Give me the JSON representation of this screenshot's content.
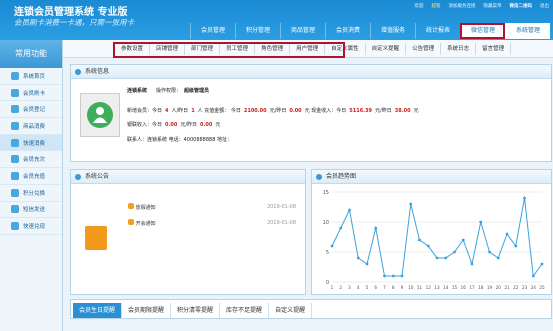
{
  "app": {
    "title": "连锁会员管理系统 专业版",
    "slogan": "会员刷卡消费一卡通，只需一张用卡"
  },
  "toplinks": [
    "欢迎",
    "超管",
    "添加服务连接",
    "隐藏菜单",
    "微信二维码",
    "退出"
  ],
  "nav": [
    "会员管理",
    "积分管理",
    "商品管理",
    "会员消费",
    "增值服务",
    "统计报表",
    "微信管理",
    "系统管理"
  ],
  "subnav": [
    "参数设置",
    "店铺管理",
    "部门管理",
    "员工管理",
    "角色管理",
    "用户管理",
    "自定义属性",
    "自定义提醒",
    "公告管理",
    "系统日志",
    "留言管理"
  ],
  "sidebar": {
    "title": "常用功能",
    "items": [
      "系统首页",
      "会员刷卡",
      "会员登记",
      "商品消费",
      "快速消费",
      "会员充次",
      "会员充值",
      "积分兑换",
      "短信发送",
      "快速兑现"
    ]
  },
  "sysinfo": {
    "title": "系统信息",
    "store": "连锁系统",
    "role_label": "操作权限：",
    "role": "超级管理员",
    "row2": {
      "l1": "新增会员：今日",
      "v1": "4",
      "l2": "人/昨日",
      "v2": "1",
      "l3": "人  充值金额：  今日",
      "v3": "2100.00",
      "l4": "元/昨日",
      "v4": "0.00",
      "l5": "元  现金收入：今日",
      "v5": "5116.39",
      "l6": "元/昨日",
      "v6": "38.00",
      "l7": "元"
    },
    "row3": {
      "l1": "银联收入：今日",
      "v1": "0.00",
      "l2": "元/昨日",
      "v2": "0.00",
      "l3": "元"
    },
    "row4": "联系人：连锁系统   电话：4000888888   地址："
  },
  "notice": {
    "title": "系统公告",
    "items": [
      {
        "text": "放假通知",
        "date": "2019-01-08"
      },
      {
        "text": "开会通知",
        "date": "2019-01-08"
      }
    ]
  },
  "trend": {
    "title": "会员趋势图"
  },
  "tabs": [
    "会员生日提醒",
    "会员期限提醒",
    "积分清零提醒",
    "库存不足提醒",
    "自定义提醒"
  ],
  "colors": {
    "header": "#1a8ad3",
    "accent": "#2b8fd3",
    "highlight": "#b0132b",
    "line": "#3aa3de"
  },
  "chart_data": {
    "type": "line",
    "x": [
      1,
      2,
      3,
      4,
      5,
      6,
      7,
      8,
      9,
      10,
      11,
      12,
      13,
      14,
      15,
      16,
      17,
      18,
      19,
      20,
      21,
      22,
      23,
      24,
      25
    ],
    "series": [
      {
        "values": [
          6,
          9,
          12,
          4,
          3,
          9,
          1,
          1,
          1,
          13,
          7,
          6,
          4,
          4,
          5,
          7,
          3,
          10,
          5,
          4,
          8,
          6,
          14,
          1,
          3
        ]
      }
    ],
    "ylim": [
      0,
      15
    ],
    "yticks": [
      0,
      5,
      10,
      15
    ],
    "grid": true
  }
}
